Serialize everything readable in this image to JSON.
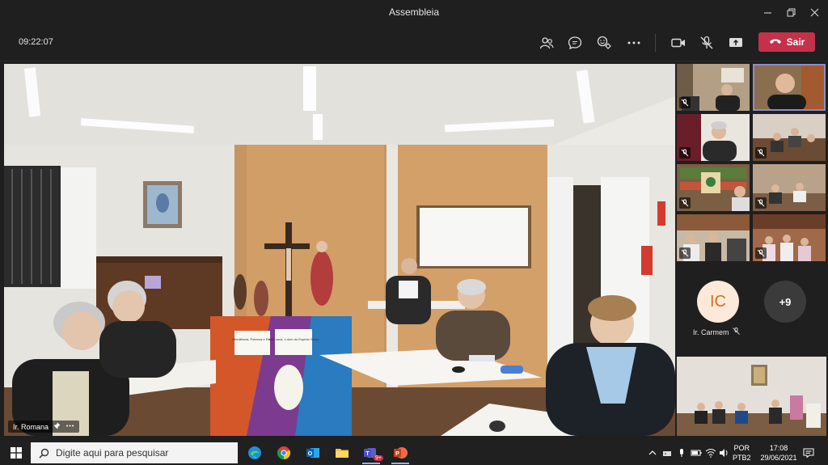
{
  "window": {
    "title": "Assembleia",
    "controls": [
      "minimize-icon",
      "maximize-icon",
      "close-icon"
    ]
  },
  "toolbar": {
    "clock": "09:22:07",
    "icons": [
      "participants-icon",
      "chat-icon",
      "reactions-icon",
      "more-options-icon",
      "camera-icon",
      "mic-off-icon",
      "share-screen-icon"
    ],
    "leave_label": "Sair",
    "leave_color": "#c4314b"
  },
  "stage": {
    "participant_name": "Ir. Romana",
    "signs": {
      "sign_left": "Obediência, Pobreza e Pa...",
      "sign_right": "Vida nova, o dom do Espírito Santo"
    }
  },
  "gallery": {
    "active_index": 1,
    "avatar_initials": "IC",
    "avatar_name": "Ir. Carmem",
    "overflow_count": "+9"
  },
  "taskbar": {
    "search_placeholder": "Digite aqui para pesquisar",
    "apps": [
      "edge-icon",
      "chrome-icon",
      "outlook-icon",
      "file-explorer-icon",
      "teams-icon",
      "powerpoint-icon"
    ],
    "teams_badge": "9+",
    "lang_top": "POR",
    "lang_bottom": "PTB2",
    "time": "17:08",
    "date": "29/06/2021"
  }
}
